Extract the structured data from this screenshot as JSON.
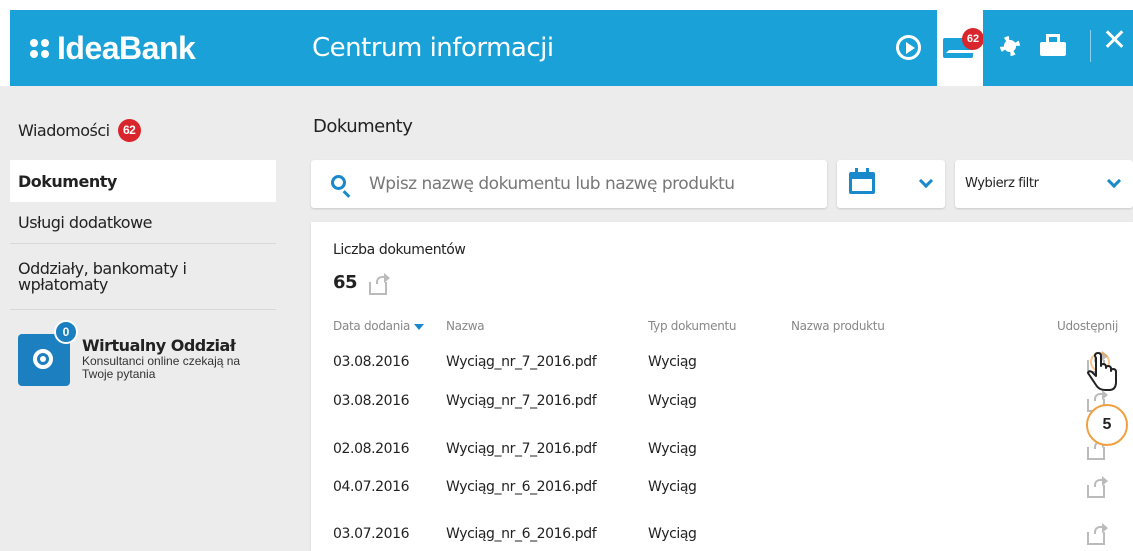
{
  "header": {
    "logo_text": "IdeaBank",
    "title": "Centrum informacji",
    "mail_badge": "62",
    "brand_color": "#1aa1d8",
    "badge_color": "#d8262c",
    "icons": [
      "play-circle-icon",
      "mail-icon",
      "gear-icon",
      "print-icon",
      "close-icon"
    ]
  },
  "sidebar": {
    "items": [
      {
        "label": "Wiadomości",
        "badge": "62"
      },
      {
        "label": "Dokumenty",
        "active": true
      },
      {
        "label": "Usługi dodatkowe"
      },
      {
        "label": "Oddziały, bankomaty i wpłatomaty"
      }
    ],
    "virtual": {
      "title": "Wirtualny Oddział",
      "subtitle": "Konsultanci online czekają na Twoje pytania",
      "badge": "0"
    }
  },
  "main": {
    "title": "Dokumenty",
    "search": {
      "placeholder": "Wpisz nazwę dokumentu lub nazwę produktu",
      "value": ""
    },
    "filter": {
      "label": "Wybierz filtr"
    },
    "count_label": "Liczba dokumentów",
    "count_value": "65",
    "columns": [
      "Data dodania",
      "Nazwa",
      "Typ dokumentu",
      "Nazwa produktu",
      "Udostępnij"
    ],
    "rows": [
      {
        "date": "03.08.2016",
        "name": "Wyciąg_nr_7_2016.pdf",
        "type": "Wyciąg",
        "product": ""
      },
      {
        "date": "03.08.2016",
        "name": "Wyciąg_nr_7_2016.pdf",
        "type": "Wyciąg",
        "product": ""
      },
      {
        "date": "02.08.2016",
        "name": "Wyciąg_nr_7_2016.pdf",
        "type": "Wyciąg",
        "product": ""
      },
      {
        "date": "04.07.2016",
        "name": "Wyciąg_nr_6_2016.pdf",
        "type": "Wyciąg",
        "product": ""
      },
      {
        "date": "03.07.2016",
        "name": "Wyciąg_nr_6_2016.pdf",
        "type": "Wyciąg",
        "product": ""
      }
    ]
  },
  "annotation": {
    "step": "5"
  }
}
